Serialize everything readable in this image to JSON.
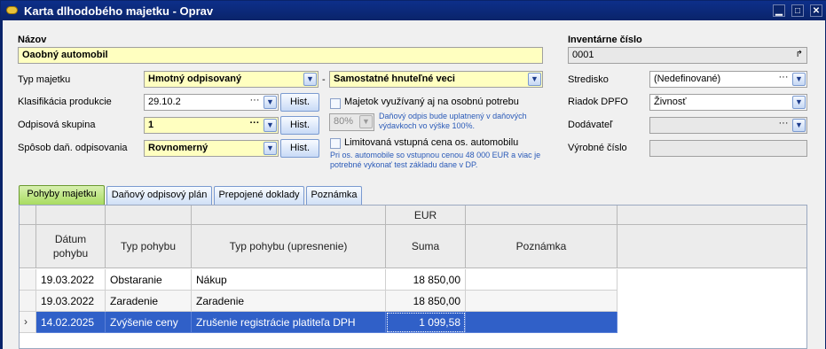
{
  "window": {
    "title": "Karta dlhodobého majetku - Oprav"
  },
  "form": {
    "name_label": "Názov",
    "name_value": "Oaobný automobil",
    "inv_label": "Inventárne číslo",
    "inv_value": "0001",
    "typ_label": "Typ majetku",
    "typ_value": "Hmotný odpisovaný",
    "typ2_value": "Samostatné hnuteľné veci",
    "typ_dash": "-",
    "klas_label": "Klasifikácia produkcie",
    "klas_value": "29.10.2",
    "odp_label": "Odpisová skupina",
    "odp_value": "1",
    "sposob_label": "Spôsob daň. odpisovania",
    "sposob_value": "Rovnomerný",
    "hist_label": "Hist.",
    "osobna_label": "Majetok využívaný aj na osobnú potrebu",
    "percent_value": "80%",
    "percent_note": "Daňový odpis bude uplatnený v daňových výdavkoch vo výške 100%.",
    "limit_label": "Limitovaná vstupná cena os. automobilu",
    "limit_note": "Pri os. automobile so vstupnou cenou  48 000 EUR a viac je potrebné vykonať test základu dane v DP.",
    "stredisko_label": "Stredisko",
    "stredisko_value": "(Nedefinované)",
    "riadok_label": "Riadok DPFO",
    "riadok_value": "Živnosť",
    "dodavatel_label": "Dodávateľ",
    "dodavatel_value": "",
    "vyrobne_label": "Výrobné číslo",
    "vyrobne_value": ""
  },
  "tabs": [
    {
      "label": "Pohyby majetku"
    },
    {
      "label": "Daňový odpisový plán"
    },
    {
      "label": "Prepojené doklady"
    },
    {
      "label": "Poznámka"
    }
  ],
  "grid": {
    "group_header": "EUR",
    "columns": [
      "Dátum pohybu",
      "Typ pohybu",
      "Typ pohybu (upresnenie)",
      "Suma",
      "Poznámka"
    ],
    "rows": [
      {
        "date": "19.03.2022",
        "typ": "Obstaranie",
        "upr": "Nákup",
        "suma": "18 850,00",
        "pozn": ""
      },
      {
        "date": "19.03.2022",
        "typ": "Zaradenie",
        "upr": "Zaradenie",
        "suma": "18 850,00",
        "pozn": ""
      },
      {
        "date": "14.02.2025",
        "typ": "Zvýšenie ceny",
        "upr": "Zrušenie registrácie platiteľa DPH",
        "suma": "1 099,58",
        "pozn": ""
      }
    ]
  },
  "icons": {
    "dropdown": "chevron-down-icon",
    "ellipsis": "ellipsis-icon",
    "row_pointer": "row-pointer-icon"
  }
}
